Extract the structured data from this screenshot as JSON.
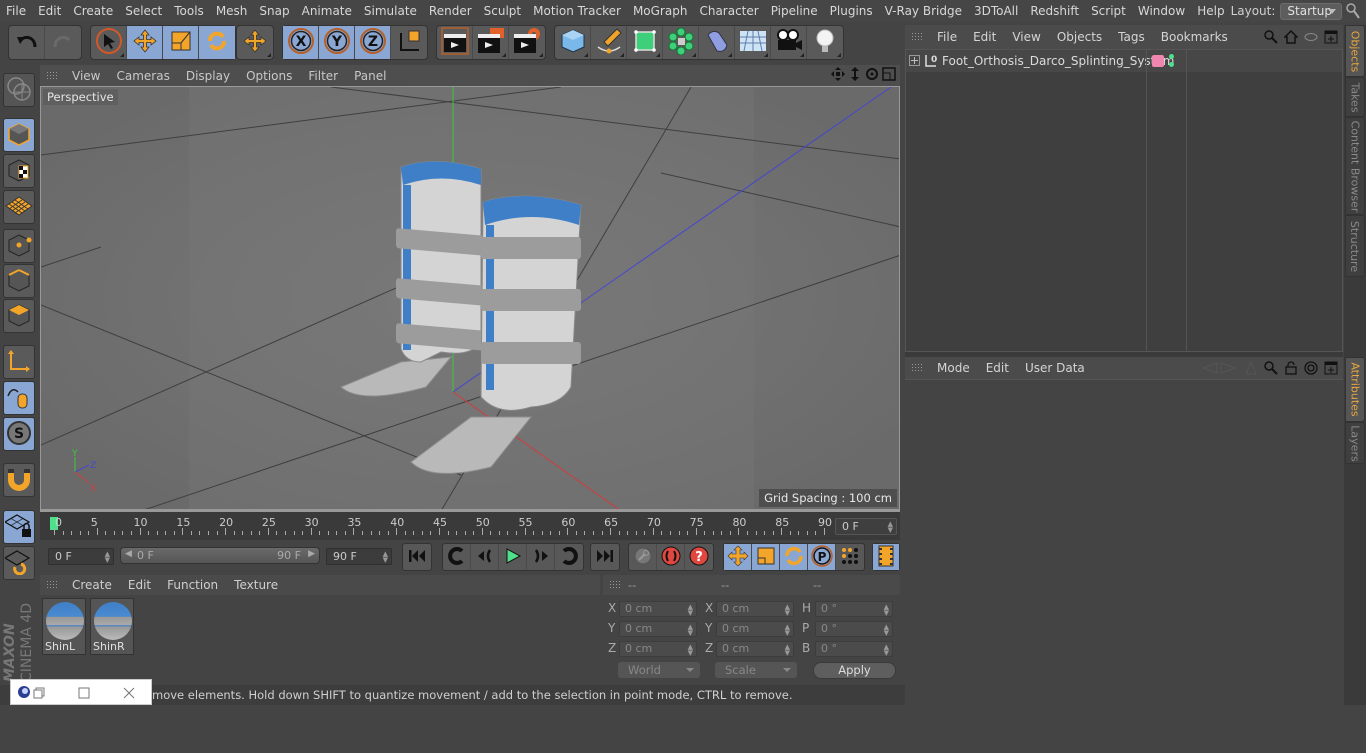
{
  "menubar": {
    "items": [
      "File",
      "Edit",
      "Create",
      "Select",
      "Tools",
      "Mesh",
      "Snap",
      "Animate",
      "Simulate",
      "Render",
      "Sculpt",
      "Motion Tracker",
      "MoGraph",
      "Character",
      "Pipeline",
      "Plugins",
      "V-Ray Bridge",
      "3DToAll",
      "Redshift",
      "Script",
      "Window",
      "Help"
    ],
    "layout_label": "Layout:",
    "layout_value": "Startup"
  },
  "toolbar": {
    "groups": [
      {
        "name": "history",
        "icons": [
          "undo-icon",
          "redo-icon"
        ]
      },
      {
        "name": "modes",
        "icons": [
          "live-selection-icon",
          "move-icon",
          "scale-icon",
          "rotate-icon"
        ]
      },
      {
        "name": "recent",
        "icons": [
          "move-recent-icon"
        ]
      },
      {
        "name": "axes",
        "icons": [
          "x-axis-lock-icon",
          "y-axis-lock-icon",
          "z-axis-lock-icon",
          "coordinate-system-icon"
        ]
      },
      {
        "name": "render",
        "icons": [
          "render-view-icon",
          "render-picture-viewer-icon",
          "render-settings-icon"
        ]
      },
      {
        "name": "objects",
        "icons": [
          "cube-icon",
          "pen-spline-icon",
          "subdivision-icon",
          "cloner-icon",
          "deformer-icon",
          "floor-icon",
          "camera-icon",
          "light-icon"
        ]
      }
    ],
    "active": [
      "move-icon",
      "scale-icon",
      "rotate-icon",
      "x-axis-lock-icon",
      "y-axis-lock-icon",
      "z-axis-lock-icon"
    ]
  },
  "left_toolbar": {
    "icons": [
      "make-editable-icon",
      "model-mode-icon",
      "texture-mode-icon",
      "workplane-mode-icon",
      "points-mode-icon",
      "edges-mode-icon",
      "polygons-mode-icon",
      "axis-mode-icon",
      "tweak-mode-icon",
      "solo-icon",
      "snap-magnet-icon",
      "lock-workplane-icon",
      "workplane-sync-icon"
    ],
    "logo_brand": "MAXON",
    "logo_product": "CINEMA 4D"
  },
  "viewport": {
    "menu": [
      "View",
      "Cameras",
      "Display",
      "Options",
      "Filter",
      "Panel"
    ],
    "camera_label": "Perspective",
    "grid_spacing": "Grid Spacing : 100 cm",
    "nav_icons": [
      "pan-icon",
      "dolly-icon",
      "orbit-icon",
      "maximize-view-icon"
    ],
    "axis_labels": {
      "x": "X",
      "y": "Y",
      "z": "Z"
    },
    "axis_colors": {
      "x": "#d23c3c",
      "y": "#3cc83c",
      "z": "#4646d2"
    }
  },
  "timeline": {
    "ticks": [
      "0",
      "5",
      "10",
      "15",
      "20",
      "25",
      "30",
      "35",
      "40",
      "45",
      "50",
      "55",
      "60",
      "65",
      "70",
      "75",
      "80",
      "85",
      "90"
    ],
    "current_frame": "0 F",
    "start_frame": "0 F",
    "range_start": "0 F",
    "range_end": "90 F",
    "end_frame": "90 F",
    "playhead_frame": 0,
    "max_frame": 90
  },
  "playback": {
    "buttons": [
      "go-to-start-icon",
      "previous-key-icon",
      "previous-frame-icon",
      "play-icon",
      "next-frame-icon",
      "next-key-icon",
      "go-to-end-icon"
    ],
    "key_buttons": [
      "keyframe-selection-icon",
      "autokey-icon",
      "record-help-icon"
    ],
    "key_mode_buttons": [
      "key-position-icon",
      "key-scale-icon",
      "key-rotation-icon",
      "key-parameter-icon",
      "key-pla-icon"
    ],
    "timeline_button": "timeline-window-icon"
  },
  "material_manager": {
    "menu": [
      "Create",
      "Edit",
      "Function",
      "Texture"
    ],
    "materials": [
      {
        "name": "ShinL"
      },
      {
        "name": "ShinR"
      }
    ]
  },
  "coordinates": {
    "headers": [
      "--",
      "--",
      "--"
    ],
    "rows": [
      {
        "l1": "X",
        "v1": "0 cm",
        "l2": "X",
        "v2": "0 cm",
        "l3": "H",
        "v3": "0 °"
      },
      {
        "l1": "Y",
        "v1": "0 cm",
        "l2": "Y",
        "v2": "0 cm",
        "l3": "P",
        "v3": "0 °"
      },
      {
        "l1": "Z",
        "v1": "0 cm",
        "l2": "Z",
        "v2": "0 cm",
        "l3": "B",
        "v3": "0 °"
      }
    ],
    "space_dropdown": "World",
    "mode_dropdown": "Scale",
    "apply_label": "Apply"
  },
  "object_manager": {
    "menu": [
      "File",
      "Edit",
      "View",
      "Objects",
      "Tags",
      "Bookmarks"
    ],
    "objects": [
      {
        "name": "Foot_Orthosis_Darco_Splinting_System",
        "layer_color": "#ef86b0",
        "status_color": "#4ee08a"
      }
    ]
  },
  "attribute_manager": {
    "menu": [
      "Mode",
      "Edit",
      "User Data"
    ]
  },
  "side_tabs": {
    "top": [
      "Objects",
      "Takes",
      "Content Browser",
      "Structure"
    ],
    "bottom": [
      "Attributes",
      "Layers"
    ],
    "active_top": "Objects",
    "active_bottom": "Attributes"
  },
  "statusbar": {
    "text": "move elements. Hold down SHIFT to quantize movement / add to the selection in point mode, CTRL to remove."
  },
  "colors": {
    "accent_orange": "#f3a52a",
    "active_blue": "#8aa7d4",
    "tab_active_text": "#e8a640"
  }
}
